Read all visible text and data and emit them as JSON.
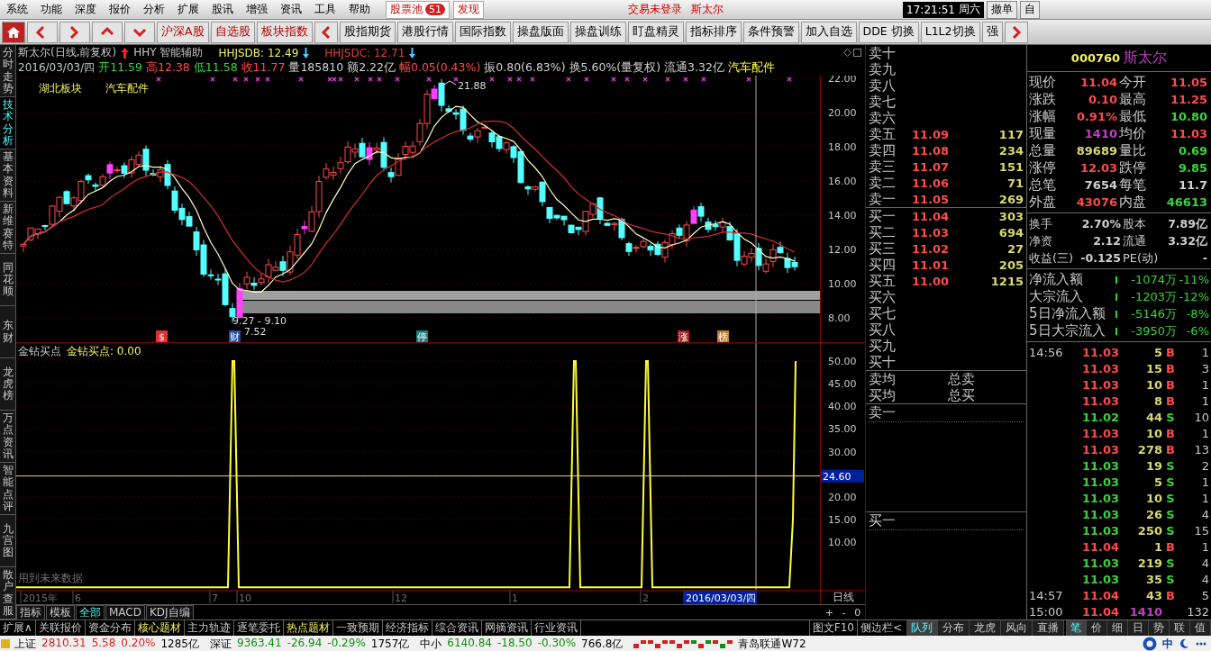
{
  "menu": {
    "items": [
      "系统",
      "功能",
      "深度",
      "报价",
      "分析",
      "扩展",
      "股讯",
      "增强",
      "资讯",
      "工具",
      "帮助"
    ],
    "pool": {
      "label": "股票池",
      "badge": "51"
    },
    "discover": "发现",
    "login": "交易未登录",
    "stock": "斯太尔",
    "clock": "17:21:51",
    "weekday": "周六",
    "buttons": [
      "撤单",
      "自"
    ]
  },
  "toolbar": {
    "groups": [
      "沪深A股",
      "自选股",
      "板块指数"
    ],
    "items": [
      "股指期货",
      "港股行情",
      "国际指数",
      "操盘版面",
      "操盘训练",
      "盯盘精灵",
      "指标排序",
      "条件预警",
      "加入自选",
      "DDE 切换",
      "L1L2切换",
      "强"
    ]
  },
  "side_tabs": [
    {
      "label": "分时走势",
      "selected": false
    },
    {
      "label": "技术分析",
      "selected": true
    },
    {
      "label": "基本资料",
      "selected": false
    },
    {
      "label": "新维赛特",
      "selected": false
    },
    {
      "label": "同花顺",
      "selected": false
    },
    {
      "label": "东财",
      "selected": false
    },
    {
      "label": "龙虎榜",
      "selected": false
    },
    {
      "label": "万点资讯",
      "selected": false
    },
    {
      "label": "智能点评",
      "selected": false
    },
    {
      "label": "九宫图",
      "selected": false
    },
    {
      "label": "散户查服",
      "selected": false
    }
  ],
  "chart": {
    "title": "斯太尔(日线,前复权)",
    "assist": "HHY 智能辅助",
    "indicators": [
      {
        "text": "HHJSDB: 12.49",
        "color": "#f0f060"
      },
      {
        "text": "HHJSDC: 12.71",
        "color": "#e04040"
      }
    ],
    "date": "2016/03/03/四",
    "fields": [
      {
        "text": "开11.59",
        "color": "#3cd23c"
      },
      {
        "text": "高12.38",
        "color": "#ff4a4a"
      },
      {
        "text": "低11.58",
        "color": "#3cd23c"
      },
      {
        "text": "收11.77",
        "color": "#ff4a4a"
      },
      {
        "text": "量185810",
        "color": "#d0d0d0"
      },
      {
        "text": "额2.22亿",
        "color": "#d0d0d0"
      },
      {
        "text": "幅0.05(0.43%)",
        "color": "#ff4a4a"
      },
      {
        "text": "振0.80(6.83%)",
        "color": "#d0d0d0"
      },
      {
        "text": "换5.60%(量复权)",
        "color": "#d0d0d0"
      },
      {
        "text": "流通3.32亿",
        "color": "#d0d0d0"
      },
      {
        "text": "汽车配件",
        "color": "#ffff40"
      }
    ],
    "sectors": [
      "湖北板块",
      "汽车配件"
    ],
    "price_labels": [
      "21.88",
      "9.27 - 9.10",
      "7.52"
    ],
    "events": [
      {
        "text": "$",
        "color": "#e03030"
      },
      {
        "text": "财",
        "color": "#2050a0"
      },
      {
        "text": "停",
        "color": "#208080"
      },
      {
        "text": "涨",
        "color": "#a02020"
      },
      {
        "text": "榜",
        "color": "#c08020"
      }
    ],
    "price_axis": [
      "22.00",
      "20.00",
      "18.00",
      "16.00",
      "14.00",
      "12.00",
      "10.00",
      "8.00"
    ]
  },
  "indicator": {
    "name": "金钻买点",
    "reading": "金钻买点: 0.00",
    "axis": [
      "50.00",
      "45.00",
      "40.00",
      "35.00",
      "30.00",
      "20.00",
      "15.00",
      "10.00"
    ],
    "cursor_value": "24.60",
    "note": "用到未来数据"
  },
  "x_axis": {
    "labels": [
      "2015年",
      "6",
      "7",
      "10",
      "12",
      "1",
      "2"
    ],
    "cursor_date": "2016/03/03/四",
    "period": "日线",
    "zoom": [
      "+",
      "-",
      "0"
    ]
  },
  "chart_tabs": [
    {
      "label": "指标",
      "selected": false
    },
    {
      "label": "模板",
      "selected": false
    },
    {
      "label": "全部",
      "selected": true
    },
    {
      "label": "MACD",
      "selected": false
    },
    {
      "label": "KDJ自编",
      "selected": false
    }
  ],
  "order_book": {
    "sell": [
      {
        "label": "卖十"
      },
      {
        "label": "卖九"
      },
      {
        "label": "卖八"
      },
      {
        "label": "卖七"
      },
      {
        "label": "卖六"
      },
      {
        "label": "卖五",
        "price": "11.09",
        "volume": "117"
      },
      {
        "label": "卖四",
        "price": "11.08",
        "volume": "234"
      },
      {
        "label": "卖三",
        "price": "11.07",
        "volume": "151"
      },
      {
        "label": "卖二",
        "price": "11.06",
        "volume": "71"
      },
      {
        "label": "卖一",
        "price": "11.05",
        "volume": "269"
      }
    ],
    "buy": [
      {
        "label": "买一",
        "price": "11.04",
        "volume": "303"
      },
      {
        "label": "买二",
        "price": "11.03",
        "volume": "694"
      },
      {
        "label": "买三",
        "price": "11.02",
        "volume": "27"
      },
      {
        "label": "买四",
        "price": "11.01",
        "volume": "205"
      },
      {
        "label": "买五",
        "price": "11.00",
        "volume": "1215"
      },
      {
        "label": "买六"
      },
      {
        "label": "买七"
      },
      {
        "label": "买八"
      },
      {
        "label": "买九"
      },
      {
        "label": "买十"
      }
    ],
    "summary": [
      {
        "label": "卖均",
        "total": "总卖"
      },
      {
        "label": "买均",
        "total": "总买"
      }
    ],
    "queues": [
      "卖一",
      "买一"
    ]
  },
  "quote": {
    "code": "000760",
    "name": "斯太尔",
    "cells": [
      {
        "label": "现价",
        "value": "11.04",
        "color": "#ff4a4a"
      },
      {
        "label": "今开",
        "value": "11.05",
        "color": "#ff4a4a"
      },
      {
        "label": "涨跌",
        "value": "0.10",
        "color": "#ff4a4a"
      },
      {
        "label": "最高",
        "value": "11.25",
        "color": "#ff4a4a"
      },
      {
        "label": "涨幅",
        "value": "0.91%",
        "color": "#ff4a4a"
      },
      {
        "label": "最低",
        "value": "10.80",
        "color": "#3cd23c"
      },
      {
        "label": "现量",
        "value": "1410",
        "color": "#c040c0"
      },
      {
        "label": "均价",
        "value": "11.03",
        "color": "#ff4a4a"
      },
      {
        "label": "总量",
        "value": "89689",
        "color": "#d8d870"
      },
      {
        "label": "量比",
        "value": "0.69",
        "color": "#3cd23c"
      },
      {
        "label": "涨停",
        "value": "12.03",
        "color": "#ff4a4a"
      },
      {
        "label": "跌停",
        "value": "9.85",
        "color": "#3cd23c"
      },
      {
        "label": "总笔",
        "value": "7654",
        "color": "#d0d0d0"
      },
      {
        "label": "每笔",
        "value": "11.7",
        "color": "#d0d0d0"
      },
      {
        "label": "外盘",
        "value": "43076",
        "color": "#ff4a4a"
      },
      {
        "label": "内盘",
        "value": "46613",
        "color": "#3cd23c"
      }
    ],
    "cells2": [
      {
        "label": "换手",
        "value": "2.70%",
        "color": "#d0d0d0"
      },
      {
        "label": "股本",
        "value": "7.89亿",
        "color": "#d0d0d0"
      },
      {
        "label": "净资",
        "value": "2.12",
        "color": "#d0d0d0"
      },
      {
        "label": "流通",
        "value": "3.32亿",
        "color": "#d0d0d0"
      },
      {
        "label": "收益(三)",
        "value": "-0.125",
        "color": "#d0d0d0"
      },
      {
        "label": "PE(动)",
        "value": "-",
        "color": "#d0d0d0"
      }
    ],
    "flows": [
      {
        "label": "净流入额",
        "amount": "-1074万",
        "pct": "-11%"
      },
      {
        "label": "大宗流入",
        "amount": "-1203万",
        "pct": "-12%"
      },
      {
        "label": "5日净流入额",
        "amount": "-5146万",
        "pct": "-8%"
      },
      {
        "label": "5日大宗流入",
        "amount": "-3950万",
        "pct": "-6%"
      }
    ]
  },
  "trades": [
    {
      "time": "14:56",
      "price": "11.03",
      "volume": "5",
      "side": "B",
      "count": "1",
      "kind": "buy"
    },
    {
      "price": "11.03",
      "volume": "15",
      "side": "B",
      "count": "3",
      "kind": "buy"
    },
    {
      "price": "11.03",
      "volume": "10",
      "side": "B",
      "count": "1",
      "kind": "buy"
    },
    {
      "price": "11.03",
      "volume": "8",
      "side": "B",
      "count": "1",
      "kind": "buy"
    },
    {
      "price": "11.02",
      "volume": "44",
      "side": "S",
      "count": "10",
      "kind": "sell"
    },
    {
      "price": "11.03",
      "volume": "10",
      "side": "B",
      "count": "1",
      "kind": "buy"
    },
    {
      "price": "11.03",
      "volume": "278",
      "side": "B",
      "count": "13",
      "kind": "buy"
    },
    {
      "price": "11.03",
      "volume": "19",
      "side": "S",
      "count": "2",
      "kind": "sell"
    },
    {
      "price": "11.03",
      "volume": "5",
      "side": "S",
      "count": "1",
      "kind": "sell"
    },
    {
      "price": "11.03",
      "volume": "10",
      "side": "S",
      "count": "1",
      "kind": "sell"
    },
    {
      "price": "11.03",
      "volume": "26",
      "side": "S",
      "count": "4",
      "kind": "sell"
    },
    {
      "price": "11.03",
      "volume": "250",
      "side": "S",
      "count": "15",
      "kind": "sell"
    },
    {
      "price": "11.04",
      "volume": "1",
      "side": "B",
      "count": "1",
      "kind": "buy"
    },
    {
      "price": "11.03",
      "volume": "219",
      "side": "S",
      "count": "4",
      "kind": "sell"
    },
    {
      "price": "11.03",
      "volume": "35",
      "side": "S",
      "count": "4",
      "kind": "sell"
    },
    {
      "time": "14:57",
      "price": "11.04",
      "volume": "43",
      "side": "B",
      "count": "5",
      "kind": "buy"
    },
    {
      "time": "15:00",
      "price": "11.04",
      "volume": "1410",
      "count": "132",
      "kind": "close"
    }
  ],
  "bottom_tabs": [
    {
      "label": "扩展∧",
      "highlight": false
    },
    {
      "label": "关联报价",
      "highlight": false
    },
    {
      "label": "资金分布",
      "highlight": false
    },
    {
      "label": "核心题材",
      "highlight": true
    },
    {
      "label": "主力轨迹",
      "highlight": false
    },
    {
      "label": "逐笔委托",
      "highlight": false
    },
    {
      "label": "热点题材",
      "highlight": true
    },
    {
      "label": "一致预期",
      "highlight": false
    },
    {
      "label": "经济指标",
      "highlight": false
    },
    {
      "label": "综合资讯",
      "highlight": false
    },
    {
      "label": "网摘资讯",
      "highlight": false
    },
    {
      "label": "行业资讯",
      "highlight": false
    }
  ],
  "panel_buttons": [
    "图文F10",
    "侧边栏<"
  ],
  "panel_tabs": [
    {
      "label": "队列",
      "selected": true
    },
    {
      "label": "分布",
      "selected": false
    },
    {
      "label": "龙虎",
      "selected": false
    },
    {
      "label": "风向",
      "selected": false
    },
    {
      "label": "直播",
      "selected": false
    }
  ],
  "detail_tabs": [
    {
      "label": "笔",
      "selected": true
    },
    {
      "label": "价",
      "selected": false
    },
    {
      "label": "细",
      "selected": false
    },
    {
      "label": "日",
      "selected": false
    },
    {
      "label": "势",
      "selected": false
    },
    {
      "label": "联",
      "selected": false
    },
    {
      "label": "值",
      "selected": false
    }
  ],
  "status": {
    "indices": [
      {
        "label": "上证",
        "value": "2810.31",
        "change": "5.58",
        "pct": "0.20%",
        "amount": "1285亿",
        "rising": true
      },
      {
        "label": "深证",
        "value": "9363.41",
        "change": "-26.94",
        "pct": "-0.29%",
        "amount": "1757亿",
        "rising": false
      },
      {
        "label": "中小",
        "value": "6140.84",
        "change": "-18.50",
        "pct": "-0.30%",
        "amount": "766.8亿",
        "rising": false
      }
    ],
    "ticker": "青岛联通W72",
    "ime": "中"
  }
}
